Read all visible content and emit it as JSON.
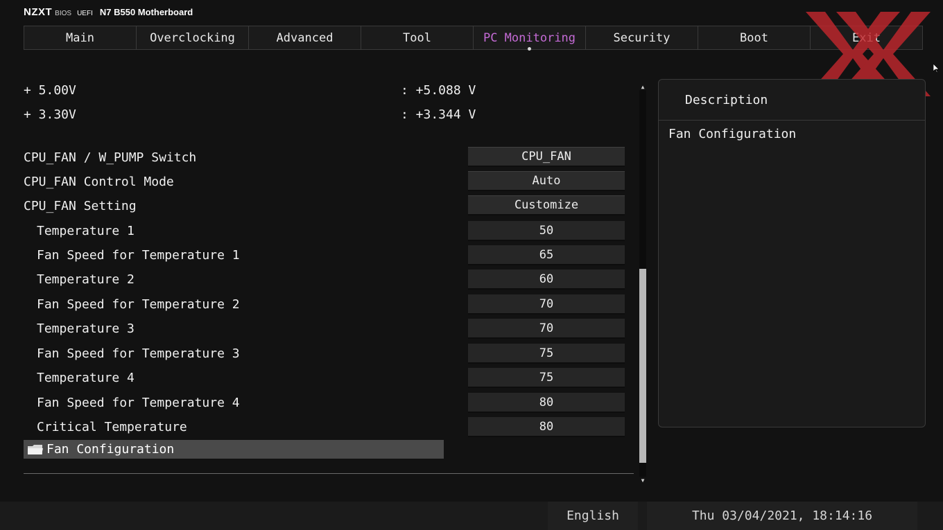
{
  "brand": {
    "logo": "NZXT",
    "bios": "BIOS",
    "uefi": "UEFI",
    "board": "N7 B550 Motherboard"
  },
  "tabs": [
    {
      "label": "Main"
    },
    {
      "label": "Overclocking"
    },
    {
      "label": "Advanced"
    },
    {
      "label": "Tool"
    },
    {
      "label": "PC Monitoring"
    },
    {
      "label": "Security"
    },
    {
      "label": "Boot"
    },
    {
      "label": "Exit"
    }
  ],
  "active_tab": "PC Monitoring",
  "accent_color": "#c56bd6",
  "voltages": [
    {
      "label": "+ 5.00V",
      "value": ": +5.088 V"
    },
    {
      "label": "+ 3.30V",
      "value": ": +3.344 V"
    }
  ],
  "settings": [
    {
      "label": "CPU_FAN / W_PUMP Switch",
      "value": "CPU_FAN"
    },
    {
      "label": "CPU_FAN Control Mode",
      "value": "Auto"
    },
    {
      "label": "CPU_FAN Setting",
      "value": "Customize"
    },
    {
      "label": "Temperature 1",
      "value": "50"
    },
    {
      "label": "Fan Speed for Temperature 1",
      "value": "65"
    },
    {
      "label": "Temperature 2",
      "value": "60"
    },
    {
      "label": "Fan Speed for Temperature 2",
      "value": "70"
    },
    {
      "label": "Temperature 3",
      "value": "70"
    },
    {
      "label": "Fan Speed for Temperature 3",
      "value": "75"
    },
    {
      "label": "Temperature 4",
      "value": "75"
    },
    {
      "label": "Fan Speed for Temperature 4",
      "value": "80"
    },
    {
      "label": "Critical Temperature",
      "value": "80"
    }
  ],
  "selected_item": {
    "label": "Fan Configuration",
    "icon": "folder-icon"
  },
  "description": {
    "title": "Description",
    "text": "Fan Configuration"
  },
  "footer": {
    "language": "English",
    "datetime": "Thu 03/04/2021, 18:14:16"
  }
}
